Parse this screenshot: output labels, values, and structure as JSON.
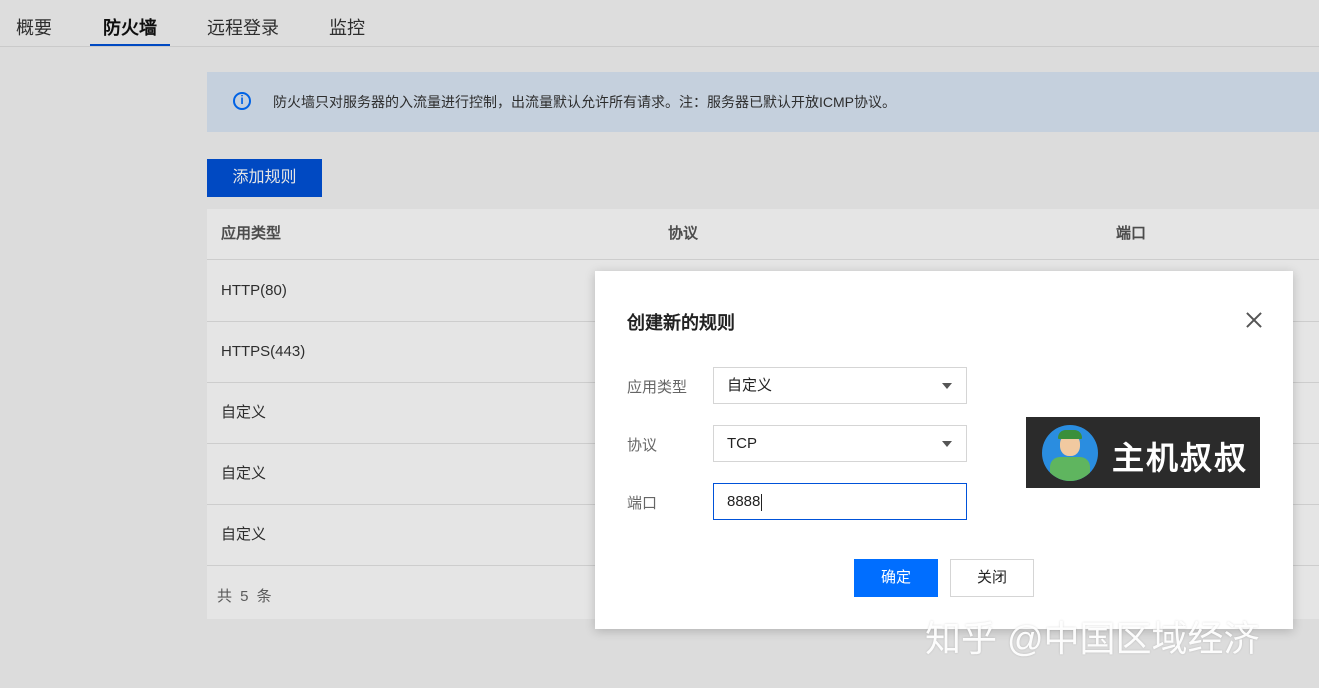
{
  "tabs": [
    {
      "label": "概要"
    },
    {
      "label": "防火墙"
    },
    {
      "label": "远程登录"
    },
    {
      "label": "监控"
    }
  ],
  "notice": {
    "text": "防火墙只对服务器的入流量进行控制，出流量默认允许所有请求。注：服务器已默认开放ICMP协议。"
  },
  "add_rule_label": "添加规则",
  "table": {
    "headers": [
      "应用类型",
      "协议",
      "端口"
    ],
    "rows": [
      {
        "app_type": "HTTP(80)"
      },
      {
        "app_type": "HTTPS(443)"
      },
      {
        "app_type": "自定义"
      },
      {
        "app_type": "自定义"
      },
      {
        "app_type": "自定义"
      }
    ],
    "footer": "共 5 条"
  },
  "modal": {
    "title": "创建新的规则",
    "fields": {
      "app_type": {
        "label": "应用类型",
        "value": "自定义"
      },
      "protocol": {
        "label": "协议",
        "value": "TCP"
      },
      "port": {
        "label": "端口",
        "value": "8888"
      }
    },
    "confirm_label": "确定",
    "close_label": "关闭"
  },
  "logo": {
    "text": "主机叔叔"
  },
  "watermark": "知乎 @中国区域经济",
  "colors": {
    "primary": "#0052d9",
    "confirm": "#006eff",
    "notice_bg": "#dce8f7"
  }
}
